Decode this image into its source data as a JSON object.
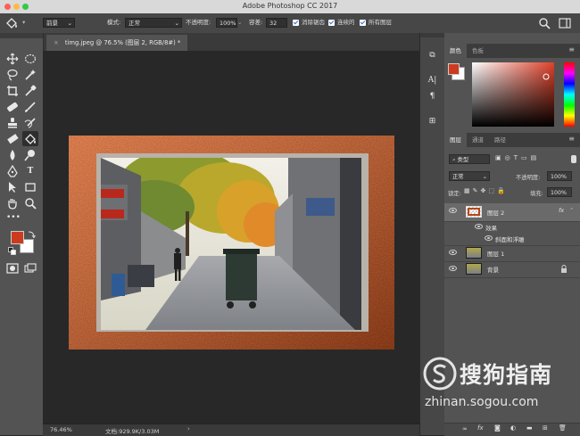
{
  "window": {
    "title": "Adobe Photoshop CC 2017"
  },
  "options_bar": {
    "tool_preset": "前景",
    "mode_label": "模式:",
    "mode_value": "正常",
    "opacity_label": "不透明度:",
    "opacity_value": "100%",
    "tolerance_label": "容差:",
    "tolerance_value": "32",
    "antialias_label": "消除锯齿",
    "contiguous_label": "连续的",
    "all_layers_label": "所有图层"
  },
  "document": {
    "tab_title": "timg.jpeg @ 76.5% (图层 2, RGB/8#) *",
    "zoom": "76.46%",
    "doc_info": "文档:929.9K/3.03M"
  },
  "colors": {
    "foreground": "#cc3b1f",
    "background": "#ffffff",
    "frame": "#a23c0e",
    "picker_hue": "#e0412a"
  },
  "color_panel": {
    "tabs": [
      "颜色",
      "色板"
    ]
  },
  "layers_panel": {
    "tabs": [
      "图层",
      "通道",
      "路径"
    ],
    "filter_kind": "类型",
    "blend_mode": "正常",
    "opacity_label": "不透明度:",
    "opacity_value": "100%",
    "lock_label": "锁定:",
    "fill_label": "填充:",
    "fill_value": "100%",
    "layers": [
      {
        "name": "图层 2",
        "fx": "fx"
      },
      {
        "name": "效果"
      },
      {
        "name": "斜面和浮雕"
      },
      {
        "name": "图层 1"
      },
      {
        "name": "背景"
      }
    ]
  },
  "watermark": {
    "brand": "搜狗指南",
    "url": "zhinan.sogou.com"
  }
}
